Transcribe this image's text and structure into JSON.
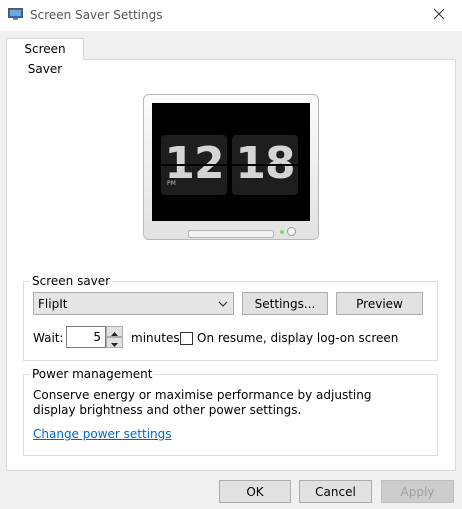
{
  "window": {
    "title": "Screen Saver Settings",
    "app_icon": "monitor-settings-icon",
    "close_icon": "close-icon"
  },
  "tabs": [
    {
      "label": "Screen Saver",
      "selected": true
    }
  ],
  "preview": {
    "hour": "12",
    "minute": "18",
    "ampm": "PM"
  },
  "screen_saver": {
    "legend": "Screen saver",
    "selected": "FlipIt",
    "settings_label": "Settings...",
    "preview_label": "Preview",
    "wait_label": "Wait:",
    "wait_value": "5",
    "minutes_label": "minutes",
    "resume_label": "On resume, display log-on screen",
    "resume_checked": false
  },
  "power": {
    "legend": "Power management",
    "description": "Conserve energy or maximise performance by adjusting display brightness and other power settings.",
    "link": "Change power settings"
  },
  "footer": {
    "ok_label": "OK",
    "cancel_label": "Cancel",
    "apply_label": "Apply",
    "apply_disabled": true
  },
  "colors": {
    "link": "#0066cc",
    "window_bg": "#f0f0f0",
    "panel_bg": "#ffffff"
  }
}
